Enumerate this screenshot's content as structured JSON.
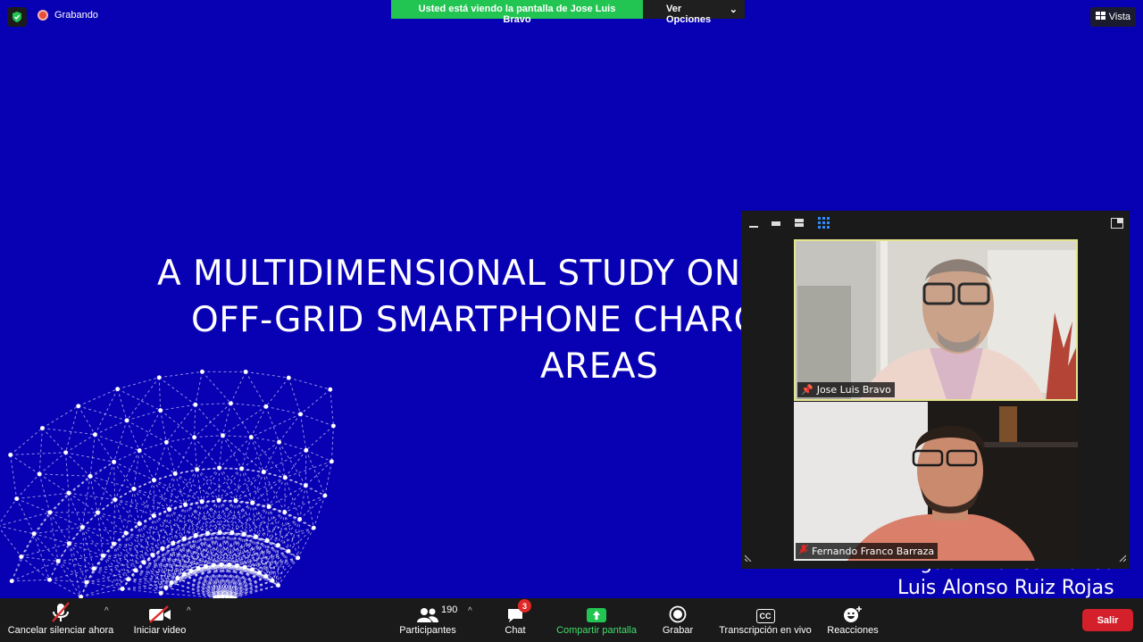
{
  "status": {
    "recording_label": "Grabando"
  },
  "banner": {
    "message": "Usted está viendo la pantalla de Jose Luis Bravo",
    "options_label": "Ver Opciones"
  },
  "view_button": {
    "label": "Vista"
  },
  "slide": {
    "title_lines": [
      "A MULTIDIMENSIONAL STUDY ON T",
      "OFF-GRID SMARTPHONE CHARG",
      "AREAS"
    ],
    "authors": [
      "Miguel Briones Blanco",
      "Luis Alonso Ruiz Rojas"
    ]
  },
  "participants_tiles": [
    {
      "name": "Jose Luis Bravo",
      "pinned": true
    },
    {
      "name": "Fernando Franco Barraza",
      "muted": true
    }
  ],
  "toolbar": {
    "mute_label": "Cancelar silenciar ahora",
    "video_label": "Iniciar video",
    "participants_label": "Participantes",
    "participants_count": "190",
    "chat_label": "Chat",
    "chat_badge": "3",
    "share_label": "Compartir pantalla",
    "record_label": "Grabar",
    "cc_label": "Transcripción en vivo",
    "cc_icon_text": "CC",
    "reactions_label": "Reacciones",
    "leave_label": "Salir"
  },
  "colors": {
    "slide_bg": "#0800b3",
    "share_green": "#23c552",
    "leave_red": "#d3202a",
    "active_tile_border": "#e5e590"
  }
}
